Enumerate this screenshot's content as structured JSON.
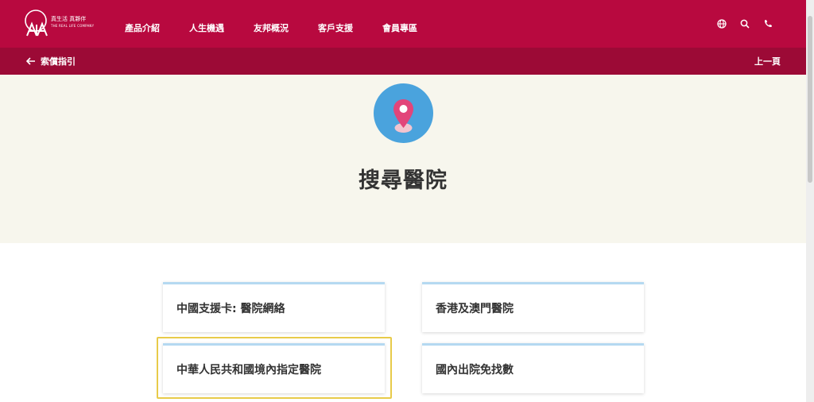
{
  "header": {
    "logo_cn": "真生活 真夥伴",
    "logo_en": "THE REAL LIFE COMPANY",
    "nav": [
      "產品介紹",
      "人生機遇",
      "友邦概況",
      "客戶支援",
      "會員專區"
    ],
    "icons": [
      "globe-icon",
      "search-icon",
      "phone-icon"
    ]
  },
  "subbar": {
    "back_label": "索償指引",
    "prev_label": "上一頁"
  },
  "hero": {
    "title": "搜尋醫院",
    "icon": "location-pin-icon"
  },
  "cards": [
    "中國支援卡: 醫院網絡",
    "香港及澳門醫院",
    "中華人民共和國境內指定醫院",
    "國內出院免找數"
  ],
  "colors": {
    "brand": "#b8093f",
    "subbar": "#9c0a36",
    "hero_bg": "#f7f6ed",
    "card_border": "#b5d9f1",
    "highlight": "#e8cb4a",
    "pin": "#e2457a",
    "pin_circle": "#4aa3dd"
  }
}
